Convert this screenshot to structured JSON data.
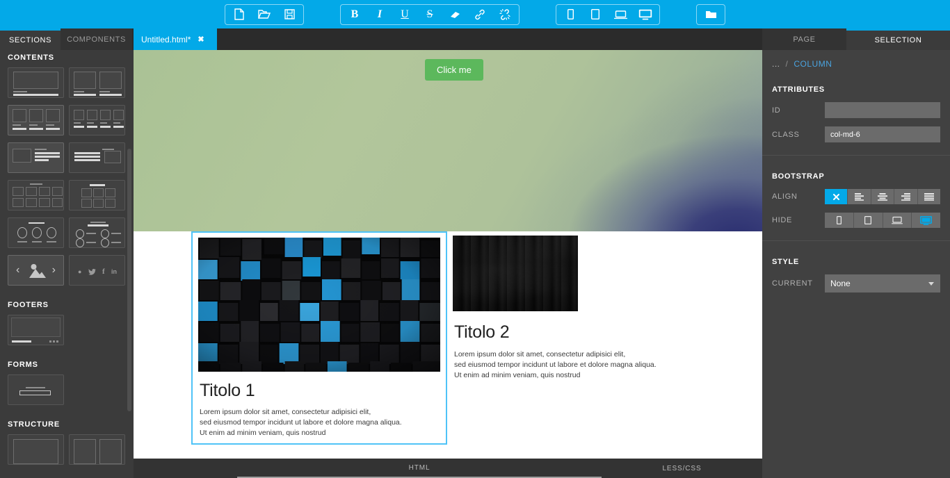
{
  "toolbar": {
    "file_group": [
      {
        "name": "new-file-icon",
        "label": "New"
      },
      {
        "name": "open-folder-icon",
        "label": "Open"
      },
      {
        "name": "save-icon",
        "label": "Save"
      }
    ],
    "format_group": [
      {
        "name": "bold-icon",
        "label": "B"
      },
      {
        "name": "italic-icon",
        "label": "I"
      },
      {
        "name": "underline-icon",
        "label": "U"
      },
      {
        "name": "strikethrough-icon",
        "label": "S"
      },
      {
        "name": "eraser-icon",
        "label": "Clear formatting"
      },
      {
        "name": "link-icon",
        "label": "Link"
      },
      {
        "name": "unlink-icon",
        "label": "Unlink"
      }
    ],
    "device_group": [
      {
        "name": "mobile-icon",
        "label": "Mobile"
      },
      {
        "name": "tablet-icon",
        "label": "Tablet"
      },
      {
        "name": "laptop-icon",
        "label": "Laptop"
      },
      {
        "name": "desktop-icon",
        "label": "Desktop"
      }
    ],
    "assets_group": [
      {
        "name": "folder-icon",
        "label": "Assets"
      }
    ]
  },
  "tabs": {
    "sections": "SECTIONS",
    "components": "COMPONENTS",
    "file": "Untitled.html*",
    "file_close": "✖",
    "page": "PAGE",
    "selection": "SELECTION"
  },
  "sidebar": {
    "groups": [
      {
        "title": "CONTENTS",
        "count": 12
      },
      {
        "title": "FOOTERS",
        "count": 1
      },
      {
        "title": "FORMS",
        "count": 1
      },
      {
        "title": "STRUCTURE",
        "count": 2
      }
    ],
    "social_icons": [
      "github-icon",
      "twitter-icon",
      "facebook-icon",
      "linkedin-icon"
    ],
    "carousel_icons": [
      "chevron-left-icon",
      "image-icon",
      "chevron-right-icon"
    ]
  },
  "canvas": {
    "hero": {
      "button_label": "Click me"
    },
    "cards": [
      {
        "title": "Titolo 1",
        "image": "blue-cubes-image",
        "lines": [
          "Lorem ipsum dolor sit amet, consectetur adipisici elit,",
          "sed eiusmod tempor incidunt ut labore et dolore magna aliqua.",
          "Ut enim ad minim veniam, quis nostrud"
        ],
        "selected": true
      },
      {
        "title": "Titolo 2",
        "image": "dark-wood-image",
        "lines": [
          "Lorem ipsum dolor sit amet, consectetur adipisici elit,",
          "sed eiusmod tempor incidunt ut labore et dolore magna aliqua.",
          "Ut enim ad minim veniam, quis nostrud"
        ],
        "selected": false
      }
    ]
  },
  "bottombar": {
    "html_tab": "HTML",
    "less_tab": "LESS/CSS"
  },
  "inspector": {
    "breadcrumb": {
      "parent": "...",
      "separator": "/",
      "current": "COLUMN"
    },
    "attributes": {
      "title": "ATTRIBUTES",
      "id_label": "ID",
      "id_value": "",
      "id_placeholder": "",
      "class_label": "CLASS",
      "class_value": "col-md-6"
    },
    "bootstrap": {
      "title": "BOOTSTRAP",
      "align_label": "ALIGN",
      "align_options": [
        {
          "name": "align-none",
          "active": true
        },
        {
          "name": "align-left",
          "active": false
        },
        {
          "name": "align-center",
          "active": false
        },
        {
          "name": "align-right",
          "active": false
        },
        {
          "name": "align-justify",
          "active": false
        }
      ],
      "hide_label": "HIDE",
      "hide_options": [
        {
          "name": "hide-mobile",
          "on": false
        },
        {
          "name": "hide-tablet",
          "on": false
        },
        {
          "name": "hide-laptop",
          "on": false
        },
        {
          "name": "hide-desktop",
          "on": true
        }
      ]
    },
    "style": {
      "title": "STYLE",
      "current_label": "CURRENT",
      "current_value": "None",
      "options": [
        "None"
      ]
    }
  },
  "colors": {
    "accent": "#03a9e8",
    "panel": "#414141",
    "sidebar": "#3b3b3b",
    "topbar": "#03a9e8",
    "button_green": "#5cb85c",
    "selection_border": "#4fc3f7"
  }
}
